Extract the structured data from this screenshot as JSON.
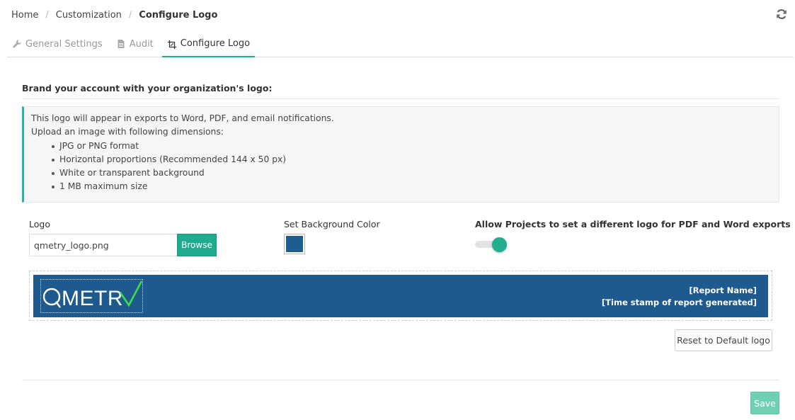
{
  "breadcrumb": {
    "items": [
      "Home",
      "Customization"
    ],
    "current": "Configure Logo",
    "separator": "/"
  },
  "tabs": [
    {
      "label": "General Settings",
      "icon": "wrench-icon",
      "active": false
    },
    {
      "label": "Audit",
      "icon": "document-icon",
      "active": false
    },
    {
      "label": "Configure Logo",
      "icon": "crop-icon",
      "active": true
    }
  ],
  "section": {
    "title": "Brand your account with your organization's logo:"
  },
  "info": {
    "line1": "This logo will appear in exports to Word, PDF, and email notifications.",
    "line2": "Upload an image with following dimensions:",
    "bullets": [
      "JPG or PNG format",
      "Horizontal proportions (Recommended 144 x 50 px)",
      "White or transparent background",
      "1 MB maximum size"
    ]
  },
  "form": {
    "logo_label": "Logo",
    "logo_value": "qmetry_logo.png",
    "browse_label": "Browse",
    "bg_label": "Set Background Color",
    "bg_color": "#1f5c8f",
    "allow_label": "Allow Projects to set a different logo for PDF and Word exports",
    "allow_enabled": true
  },
  "preview": {
    "logo_text": "QMETRY",
    "report_name": "[Report Name]",
    "timestamp": "[Time stamp of report generated]",
    "bar_color": "#1f5a8e"
  },
  "buttons": {
    "reset": "Reset to Default logo",
    "save": "Save"
  },
  "colors": {
    "accent": "#1fab8d",
    "check": "#3ddc4a"
  }
}
